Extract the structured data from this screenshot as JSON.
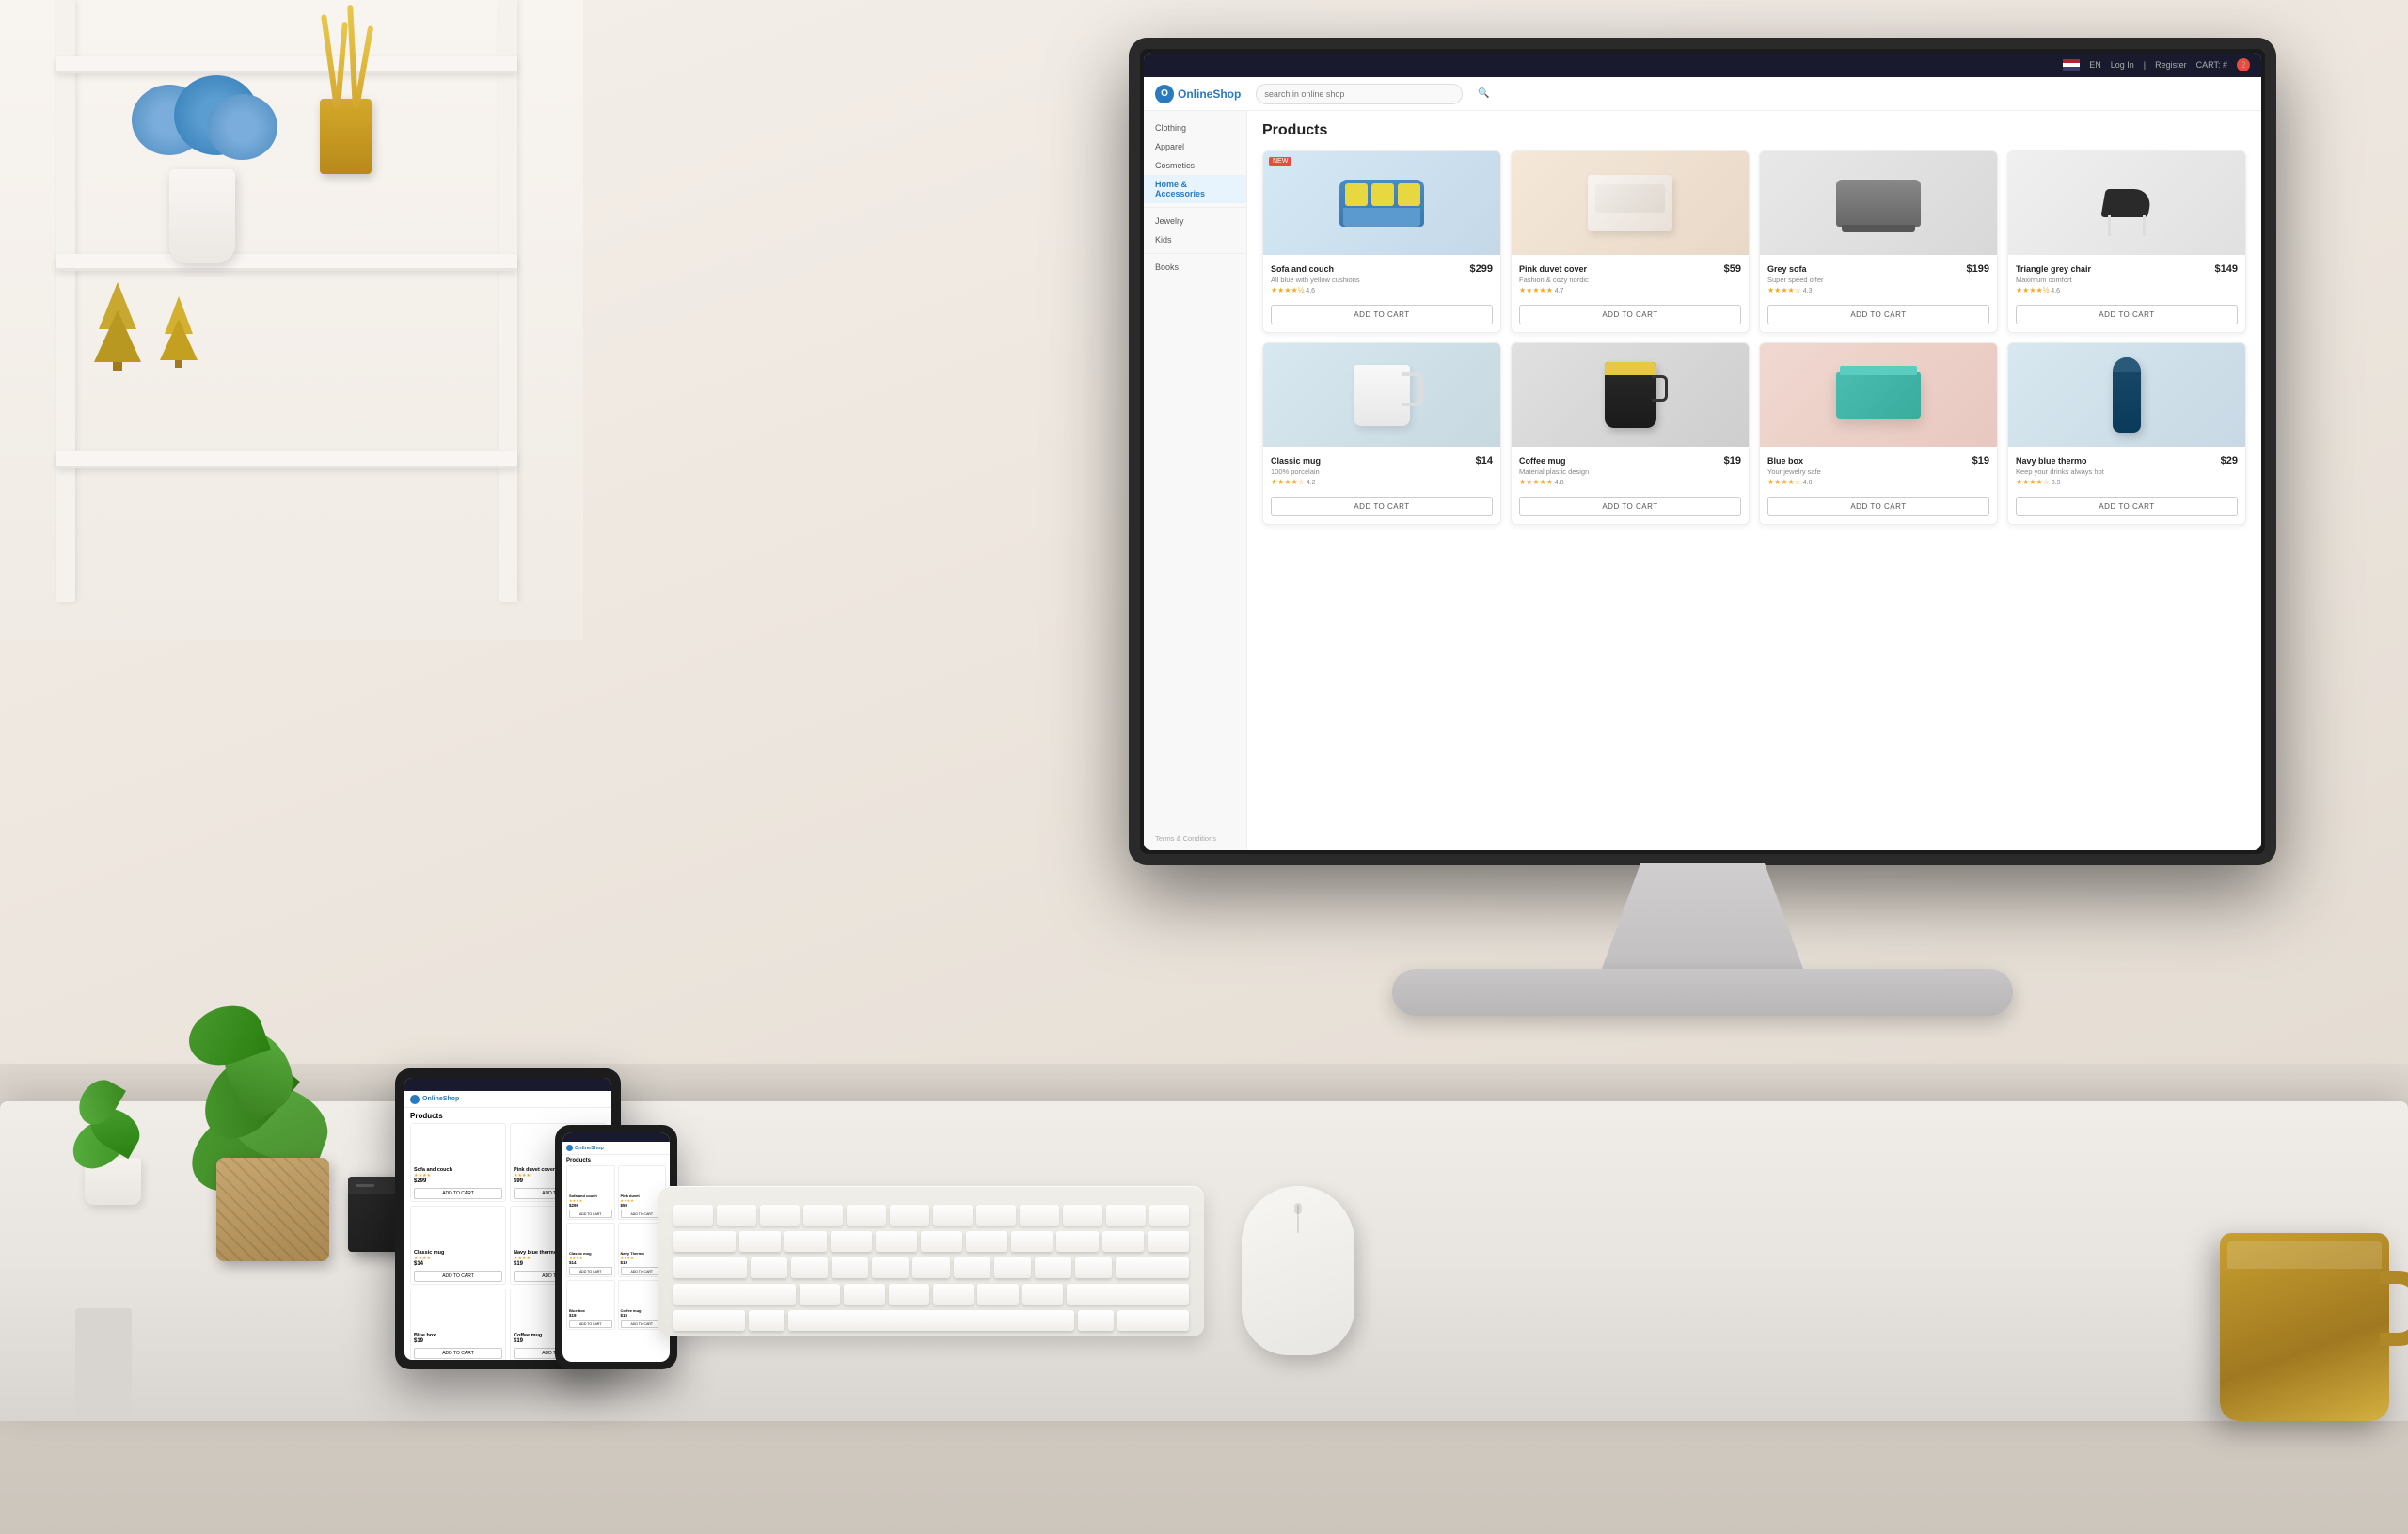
{
  "meta": {
    "title": "OnlineShop - Products",
    "dimensions": "2560x1631"
  },
  "topbar": {
    "flag_label": "EN",
    "login_label": "Log In",
    "register_label": "Register",
    "cart_label": "CART: #",
    "cart_count": "2"
  },
  "navbar": {
    "brand": "OnlineShop",
    "search_placeholder": "search in online shop"
  },
  "sidebar": {
    "categories": [
      {
        "label": "Clothing",
        "active": false
      },
      {
        "label": "Apparel",
        "active": false
      },
      {
        "label": "Cosmetics",
        "active": false
      },
      {
        "label": "Home & Accessories",
        "active": true
      },
      {
        "label": "Jewelry",
        "active": false
      },
      {
        "label": "Kids",
        "active": false
      },
      {
        "label": "Books",
        "active": false
      }
    ],
    "footer_links": [
      "Terms & Conditions"
    ]
  },
  "products": {
    "section_title": "Products",
    "items": [
      {
        "id": "sofa-couch",
        "name": "Sofa and couch",
        "description": "All blue with yellow cushions",
        "price": "$299",
        "rating": 4.6,
        "stars": "★★★★½",
        "image_type": "sofa",
        "badge": "NEW",
        "add_to_cart": "ADD TO CART"
      },
      {
        "id": "pink-duvet",
        "name": "Pink duvet cover",
        "description": "Fashion & cozy nordic",
        "price": "$59",
        "rating": 4.7,
        "stars": "★★★★½",
        "image_type": "duvet",
        "badge": null,
        "add_to_cart": "ADD TO CART"
      },
      {
        "id": "grey-sofa",
        "name": "Grey sofa",
        "description": "Super speed offer",
        "price": "$199",
        "rating": 4.3,
        "stars": "★★★★☆",
        "image_type": "grey-sofa",
        "badge": null,
        "add_to_cart": "ADD TO CART"
      },
      {
        "id": "triangle-chair",
        "name": "Triangle grey chair",
        "description": "Maximum comfort",
        "price": "$149",
        "rating": 4.6,
        "stars": "★★★★½",
        "image_type": "chair",
        "badge": null,
        "add_to_cart": "ADD TO CART"
      },
      {
        "id": "classic-mug",
        "name": "Classic mug",
        "description": "100% porcelain",
        "price": "$14",
        "rating": 4.2,
        "stars": "★★★★☆",
        "image_type": "mug",
        "badge": null,
        "add_to_cart": "ADD TO CART"
      },
      {
        "id": "coffee-mug",
        "name": "Coffee mug",
        "description": "Material plastic design",
        "price": "$19",
        "rating": 4.8,
        "stars": "★★★★★",
        "image_type": "coffee-mug",
        "badge": null,
        "add_to_cart": "ADD TO CART"
      },
      {
        "id": "blue-box",
        "name": "Blue box",
        "description": "Your jewelry safe",
        "price": "$19",
        "rating": 4.0,
        "stars": "★★★★☆",
        "image_type": "blue-box",
        "badge": null,
        "add_to_cart": "ADD TO CART"
      },
      {
        "id": "navy-thermo",
        "name": "Navy blue thermo",
        "description": "Keep your drinks always hot",
        "price": "$29",
        "rating": 3.9,
        "stars": "★★★★☆",
        "image_type": "thermo",
        "badge": null,
        "add_to_cart": "ADD TO CART"
      }
    ]
  },
  "tablet": {
    "brand": "OnlineShop",
    "products_title": "Products"
  },
  "phone": {
    "brand": "OnlineShop"
  },
  "room": {
    "desk_color": "#f0ece8",
    "wall_color": "#f8f4f0"
  }
}
